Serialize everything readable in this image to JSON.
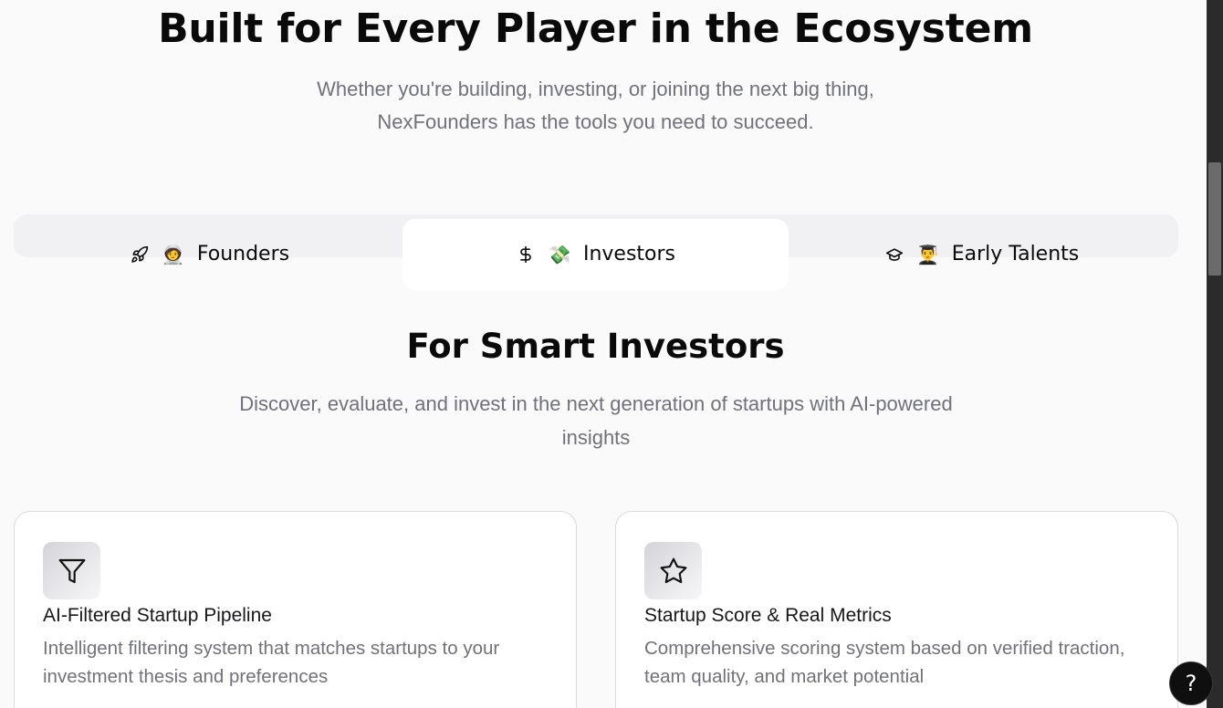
{
  "hero": {
    "title": "Built for Every Player in the Ecosystem",
    "subtitle_line1": "Whether you're building, investing, or joining the next big thing,",
    "subtitle_line2": "NexFounders has the tools you need to succeed."
  },
  "tabs": [
    {
      "label": "Founders",
      "emoji": "🧑‍🚀",
      "icon": "rocket-icon",
      "active": false
    },
    {
      "label": "Investors",
      "emoji": "💸",
      "icon": "dollar-icon",
      "active": true
    },
    {
      "label": "Early Talents",
      "emoji": "👨‍🎓",
      "icon": "graduation-cap-icon",
      "active": false
    }
  ],
  "section": {
    "title": "For Smart Investors",
    "subtitle": "Discover, evaluate, and invest in the next generation of startups with AI-powered insights"
  },
  "cards": [
    {
      "icon": "filter-icon",
      "title": "AI-Filtered Startup Pipeline",
      "description": "Intelligent filtering system that matches startups to your investment thesis and preferences"
    },
    {
      "icon": "star-icon",
      "title": "Startup Score & Real Metrics",
      "description": "Comprehensive scoring system based on verified traction, team quality, and market potential"
    }
  ],
  "help": {
    "label": "?"
  },
  "colors": {
    "background": "#fafafa",
    "muted_text": "#71717a",
    "tab_track": "#f1f1f3",
    "help_button": "#0f0f10"
  }
}
